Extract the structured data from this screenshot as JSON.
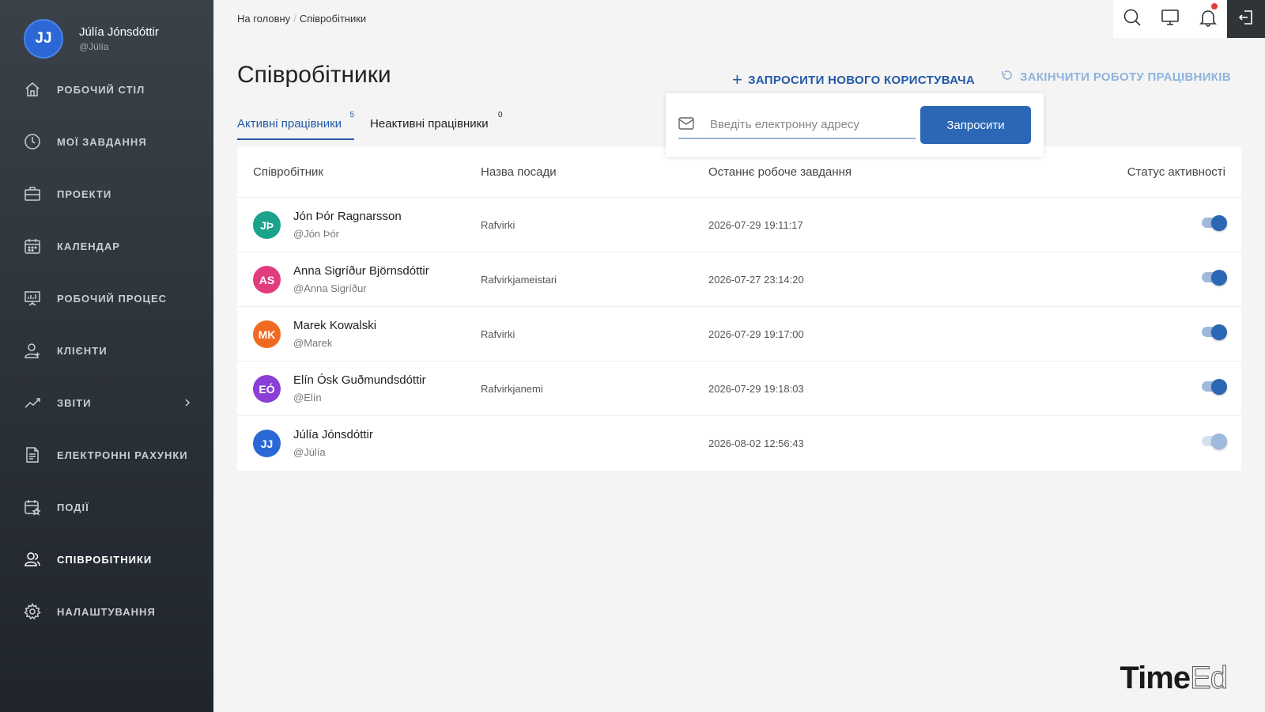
{
  "user": {
    "initials": "JJ",
    "name": "Júlía Jónsdóttir",
    "handle": "@Júlía"
  },
  "nav": [
    {
      "id": "dashboard",
      "icon": "home-icon",
      "label": "РОБОЧИЙ СТІЛ"
    },
    {
      "id": "tasks",
      "icon": "clock-icon",
      "label": "МОЇ ЗАВДАННЯ"
    },
    {
      "id": "projects",
      "icon": "briefcase-icon",
      "label": "ПРОЕКТИ"
    },
    {
      "id": "calendar",
      "icon": "calendar-icon",
      "label": "КАЛЕНДАР"
    },
    {
      "id": "workflow",
      "icon": "presentation-icon",
      "label": "РОБОЧИЙ ПРОЦЕС"
    },
    {
      "id": "clients",
      "icon": "client-icon",
      "label": "КЛІЄНТИ"
    },
    {
      "id": "reports",
      "icon": "chart-line-icon",
      "label": "ЗВІТИ"
    },
    {
      "id": "invoices",
      "icon": "document-icon",
      "label": "ЕЛЕКТРОННІ РАХУНКИ"
    },
    {
      "id": "events",
      "icon": "calendar-star-icon",
      "label": "ПОДІЇ"
    },
    {
      "id": "employees",
      "icon": "users-icon",
      "label": "СПІВРОБІТНИКИ"
    },
    {
      "id": "settings",
      "icon": "gear-icon",
      "label": "НАЛАШТУВАННЯ"
    }
  ],
  "breadcrumb": {
    "home": "На головну",
    "separator": "/",
    "current": "Співробітники"
  },
  "page": {
    "title": "Співробітники"
  },
  "actions": {
    "invite_label": "ЗАПРОСИТИ НОВОГО КОРИСТУВАЧА",
    "end_label": "ЗАКІНЧИТИ РОБОТУ ПРАЦІВНИКІВ"
  },
  "tabs": [
    {
      "label": "Активні працівники",
      "count": "5"
    },
    {
      "label": "Неактивні працівники",
      "count": "0"
    }
  ],
  "invite": {
    "placeholder": "Введіть електронну адресу",
    "button": "Запросити"
  },
  "table": {
    "headers": {
      "employee": "Співробітник",
      "position": "Назва посади",
      "last_task": "Останнє робоче завдання",
      "status": "Статус активності"
    },
    "rows": [
      {
        "initials": "JÞ",
        "color": "#1aa38a",
        "name": "Jón Þór Ragnarsson",
        "handle": "@Jón Þór",
        "position": "Rafvirki",
        "last_task": "2026-07-29 19:11:17",
        "active": true
      },
      {
        "initials": "AS",
        "color": "#e23b80",
        "name": "Anna Sigríður Björnsdóttir",
        "handle": "@Anna Sigríður",
        "position": "Rafvirkjameistari",
        "last_task": "2026-07-27 23:14:20",
        "active": true
      },
      {
        "initials": "MK",
        "color": "#f06a22",
        "name": "Marek Kowalski",
        "handle": "@Marek",
        "position": "Rafvirki",
        "last_task": "2026-07-29 19:17:00",
        "active": true
      },
      {
        "initials": "EÓ",
        "color": "#8a3fd6",
        "name": "Elín Ósk Guðmundsdóttir",
        "handle": "@Elín",
        "position": "Rafvirkjanemi",
        "last_task": "2026-07-29 19:18:03",
        "active": true
      },
      {
        "initials": "JJ",
        "color": "#2b68d6",
        "name": "Júlía Jónsdóttir",
        "handle": "@Júlía",
        "position": "",
        "last_task": "2026-08-02 12:56:43",
        "active": false
      }
    ]
  },
  "logo": {
    "part1": "Time",
    "part2": "Ed"
  }
}
